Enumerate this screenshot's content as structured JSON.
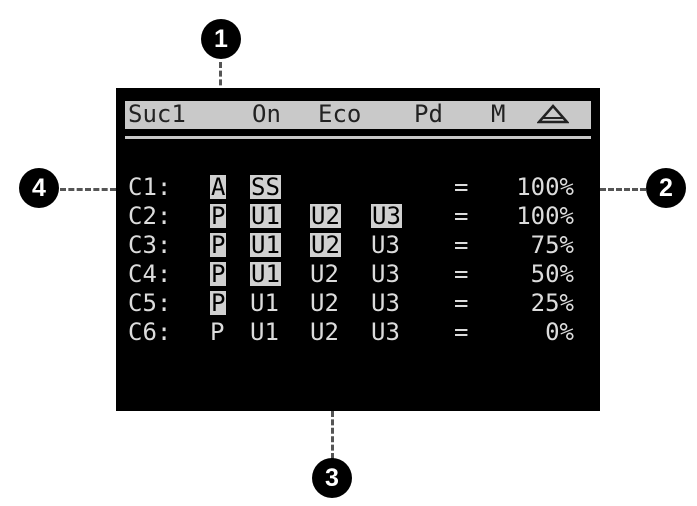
{
  "callouts": [
    "1",
    "2",
    "3",
    "4"
  ],
  "topbar": {
    "suction": "Suc1",
    "state": "On",
    "mode": "Eco",
    "pd": "Pd",
    "m": "M",
    "warning_icon": "warning-triangle-icon"
  },
  "rows": [
    {
      "label": "C1:",
      "a": "A",
      "b": "SS",
      "c": "",
      "d": "",
      "eq": "=",
      "pct": "100%"
    },
    {
      "label": "C2:",
      "a": "P",
      "b": "U1",
      "c": "U2",
      "d": "U3",
      "eq": "=",
      "pct": "100%"
    },
    {
      "label": "C3:",
      "a": "P",
      "b": "U1",
      "c": "U2",
      "d": "U3",
      "eq": "=",
      "pct": "75%"
    },
    {
      "label": "C4:",
      "a": "P",
      "b": "U1",
      "c": "U2",
      "d": "U3",
      "eq": "=",
      "pct": "50%"
    },
    {
      "label": "C5:",
      "a": "P",
      "b": "U1",
      "c": "U2",
      "d": "U3",
      "eq": "=",
      "pct": "25%"
    },
    {
      "label": "C6:",
      "a": "P",
      "b": "U1",
      "c": "U2",
      "d": "U3",
      "eq": "=",
      "pct": "0%"
    }
  ],
  "colors": {
    "lcd_bg": "#000000",
    "lcd_fg": "#dcdcdc",
    "highlight": "#d0d0d0",
    "topbar_bg": "#c9c9c9"
  }
}
